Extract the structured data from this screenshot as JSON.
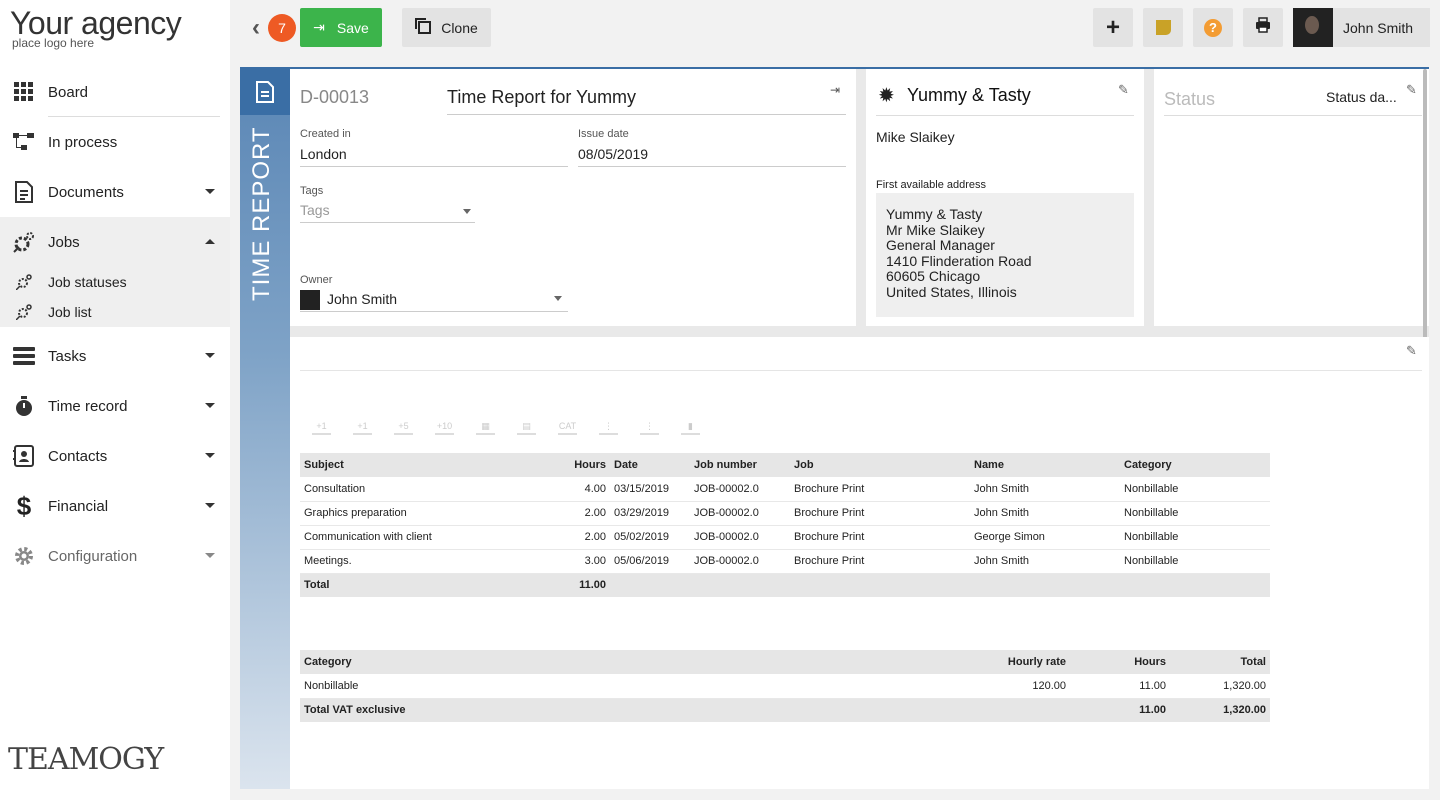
{
  "app": {
    "logo_title": "Your agency",
    "logo_sub": "place logo here",
    "footer_logo": "TEAMOGY"
  },
  "sidebar": {
    "items": [
      {
        "label": "Board",
        "icon": "board-icon"
      },
      {
        "label": "In process",
        "icon": "process-icon"
      },
      {
        "label": "Documents",
        "icon": "document-icon"
      },
      {
        "label": "Jobs",
        "icon": "jobs-icon"
      },
      {
        "label": "Job statuses",
        "icon": "job-statuses-icon"
      },
      {
        "label": "Job list",
        "icon": "job-list-icon"
      },
      {
        "label": "Tasks",
        "icon": "tasks-icon"
      },
      {
        "label": "Time record",
        "icon": "stopwatch-icon"
      },
      {
        "label": "Contacts",
        "icon": "contacts-icon"
      },
      {
        "label": "Financial",
        "icon": "dollar-icon"
      },
      {
        "label": "Configuration",
        "icon": "gear-icon"
      }
    ]
  },
  "toolbar": {
    "badge_count": "7",
    "save_label": "Save",
    "clone_label": "Clone",
    "user_name": "John Smith",
    "accent_green": "#3cb44b",
    "badge_color": "#ee5a24"
  },
  "document": {
    "type_label": "TIME REPORT",
    "number": "D-00013",
    "title": "Time Report for Yummy",
    "created_in_label": "Created in",
    "created_in": "London",
    "issue_date_label": "Issue date",
    "issue_date": "08/05/2019",
    "tags_label": "Tags",
    "tags_placeholder": "Tags",
    "owner_label": "Owner",
    "owner": "John Smith"
  },
  "customer": {
    "company": "Yummy & Tasty",
    "contact": "Mike Slaikey",
    "address_label": "First available address",
    "address_lines": [
      "Yummy & Tasty",
      "Mr  Mike Slaikey",
      "General Manager",
      "1410  Flinderation Road",
      "60605 Chicago",
      "United States, Illinois"
    ]
  },
  "status": {
    "label": "Status",
    "date_label": "Status da..."
  },
  "time_table": {
    "headers": [
      "Subject",
      "Hours",
      "Date",
      "Job number",
      "Job",
      "Name",
      "Category"
    ],
    "rows": [
      [
        "Consultation",
        "4.00",
        "03/15/2019",
        "JOB-00002.0",
        "Brochure Print",
        "John Smith",
        "Nonbillable"
      ],
      [
        "Graphics preparation",
        "2.00",
        "03/29/2019",
        "JOB-00002.0",
        "Brochure Print",
        "John Smith",
        "Nonbillable"
      ],
      [
        "Communication with client",
        "2.00",
        "05/02/2019",
        "JOB-00002.0",
        "Brochure Print",
        "George Simon",
        "Nonbillable"
      ],
      [
        "Meetings.",
        "3.00",
        "05/06/2019",
        "JOB-00002.0",
        "Brochure Print",
        "John Smith",
        "Nonbillable"
      ]
    ],
    "total_label": "Total",
    "total_hours": "11.00"
  },
  "summary_table": {
    "headers": [
      "Category",
      "Hourly rate",
      "Hours",
      "Total"
    ],
    "rows": [
      [
        "Nonbillable",
        "120.00",
        "11.00",
        "1,320.00"
      ]
    ],
    "total_label": "Total VAT exclusive",
    "total_hours": "11.00",
    "total_amount": "1,320.00"
  }
}
